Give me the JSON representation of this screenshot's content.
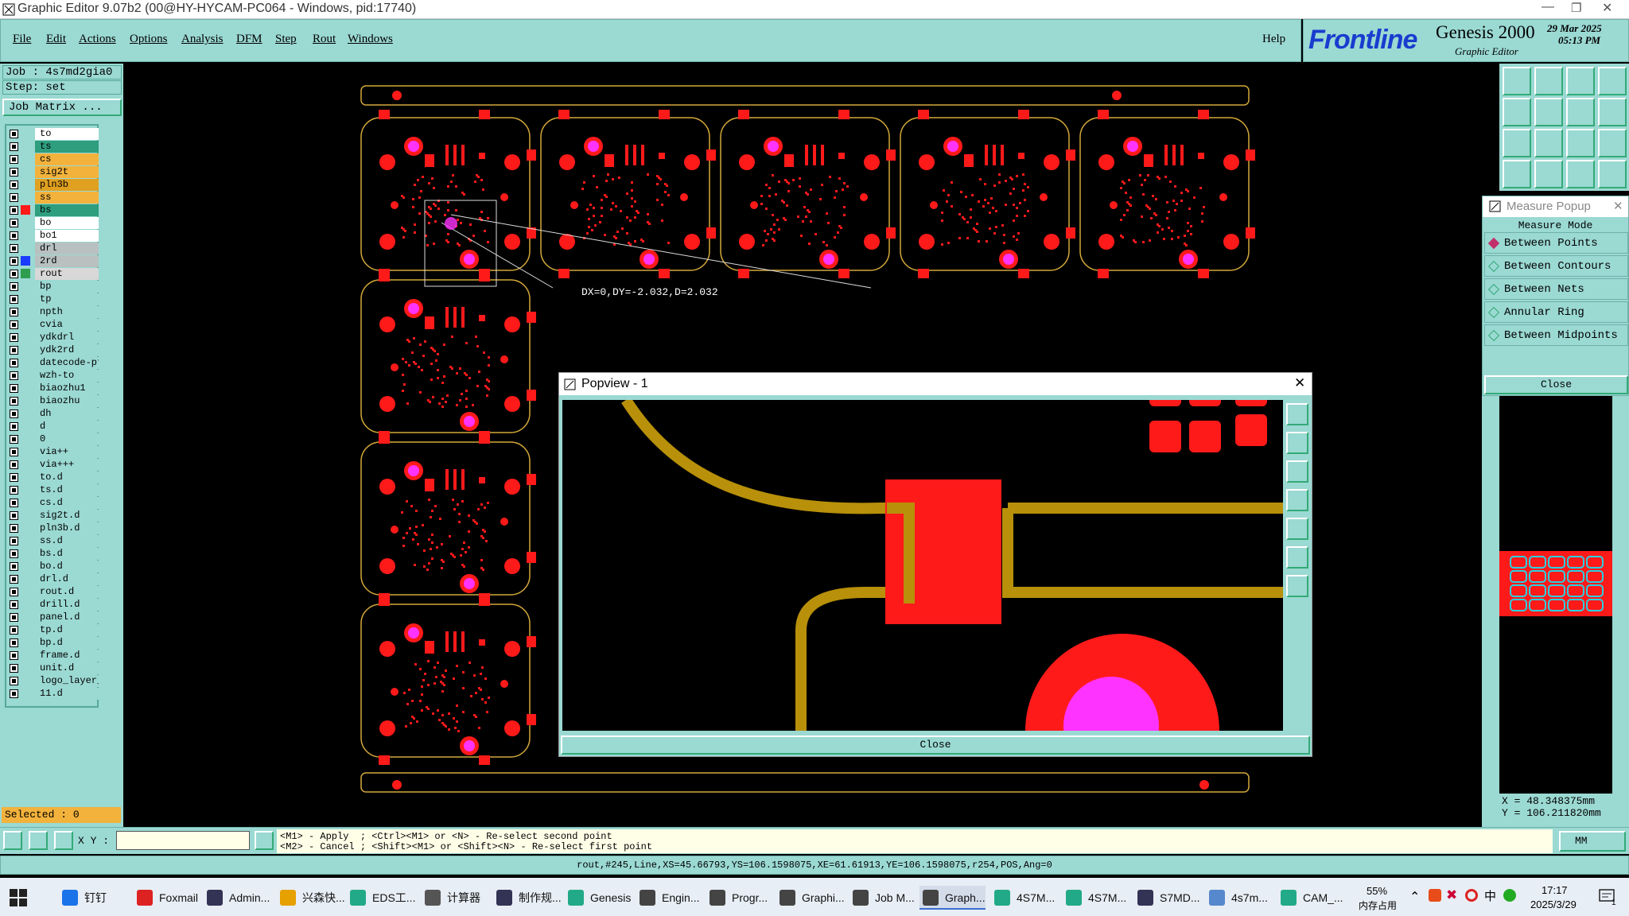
{
  "window": {
    "title": "Graphic Editor 9.07b2 (00@HY-HYCAM-PC064 - Windows, pid:17740)"
  },
  "menu": [
    "File",
    "Edit",
    "Actions",
    "Options",
    "Analysis",
    "DFM",
    "Step",
    "Rout",
    "Windows"
  ],
  "help": "Help",
  "brand": {
    "logo": "Frontline",
    "product": "Genesis 2000",
    "subtitle": "Graphic Editor",
    "date": "29 Mar 2025",
    "time": "05:13 PM"
  },
  "job": {
    "job_label": "Job : 4s7md2gia0",
    "step_label": "Step: set",
    "matrix_button": "Job Matrix ..."
  },
  "layers": [
    {
      "name": "to",
      "bg": "#ffffff",
      "sw": "#9bd9d3"
    },
    {
      "name": "ts",
      "bg": "#2e9e7e",
      "sw": "#9bd9d3"
    },
    {
      "name": "cs",
      "bg": "#f2b23c",
      "sw": "#9bd9d3"
    },
    {
      "name": "sig2t",
      "bg": "#f2b23c",
      "sw": "#9bd9d3"
    },
    {
      "name": "pln3b",
      "bg": "#e0a020",
      "sw": "#9bd9d3"
    },
    {
      "name": "ss",
      "bg": "#f2b23c",
      "sw": "#9bd9d3"
    },
    {
      "name": "bs",
      "bg": "#2e9e7e",
      "sw": "#ff1a1a"
    },
    {
      "name": "bo",
      "bg": "#ffffff",
      "sw": "#9bd9d3"
    },
    {
      "name": "bo1",
      "bg": "#ffffff",
      "sw": "#9bd9d3"
    },
    {
      "name": "drl",
      "bg": "#b8c0c0",
      "sw": "#9bd9d3"
    },
    {
      "name": "2rd",
      "bg": "#b8c0c0",
      "sw": "#1a3cff"
    },
    {
      "name": "rout",
      "bg": "#d8d8d8",
      "sw": "#2e9e4e"
    },
    {
      "name": "bp",
      "bg": "#9bd9d3",
      "sw": "#9bd9d3"
    },
    {
      "name": "tp",
      "bg": "#9bd9d3",
      "sw": "#9bd9d3"
    },
    {
      "name": "npth",
      "bg": "#9bd9d3",
      "sw": "#9bd9d3"
    },
    {
      "name": "cvia",
      "bg": "#9bd9d3",
      "sw": "#9bd9d3"
    },
    {
      "name": "ydkdrl",
      "bg": "#9bd9d3",
      "sw": "#9bd9d3"
    },
    {
      "name": "ydk2rd",
      "bg": "#9bd9d3",
      "sw": "#9bd9d3"
    },
    {
      "name": "datecode-pt",
      "bg": "#9bd9d3",
      "sw": "#9bd9d3"
    },
    {
      "name": "wzh-to",
      "bg": "#9bd9d3",
      "sw": "#9bd9d3"
    },
    {
      "name": "biaozhu1",
      "bg": "#9bd9d3",
      "sw": "#9bd9d3"
    },
    {
      "name": "biaozhu",
      "bg": "#9bd9d3",
      "sw": "#9bd9d3"
    },
    {
      "name": "dh",
      "bg": "#9bd9d3",
      "sw": "#9bd9d3"
    },
    {
      "name": "d",
      "bg": "#9bd9d3",
      "sw": "#9bd9d3"
    },
    {
      "name": "0",
      "bg": "#9bd9d3",
      "sw": "#9bd9d3"
    },
    {
      "name": "via++",
      "bg": "#9bd9d3",
      "sw": "#9bd9d3"
    },
    {
      "name": "via+++",
      "bg": "#9bd9d3",
      "sw": "#9bd9d3"
    },
    {
      "name": "to.d",
      "bg": "#9bd9d3",
      "sw": "#9bd9d3"
    },
    {
      "name": "ts.d",
      "bg": "#9bd9d3",
      "sw": "#9bd9d3"
    },
    {
      "name": "cs.d",
      "bg": "#9bd9d3",
      "sw": "#9bd9d3"
    },
    {
      "name": "sig2t.d",
      "bg": "#9bd9d3",
      "sw": "#9bd9d3"
    },
    {
      "name": "pln3b.d",
      "bg": "#9bd9d3",
      "sw": "#9bd9d3"
    },
    {
      "name": "ss.d",
      "bg": "#9bd9d3",
      "sw": "#9bd9d3"
    },
    {
      "name": "bs.d",
      "bg": "#9bd9d3",
      "sw": "#9bd9d3"
    },
    {
      "name": "bo.d",
      "bg": "#9bd9d3",
      "sw": "#9bd9d3"
    },
    {
      "name": "drl.d",
      "bg": "#9bd9d3",
      "sw": "#9bd9d3"
    },
    {
      "name": "rout.d",
      "bg": "#9bd9d3",
      "sw": "#9bd9d3"
    },
    {
      "name": "drill.d",
      "bg": "#9bd9d3",
      "sw": "#9bd9d3"
    },
    {
      "name": "panel.d",
      "bg": "#9bd9d3",
      "sw": "#9bd9d3"
    },
    {
      "name": "tp.d",
      "bg": "#9bd9d3",
      "sw": "#9bd9d3"
    },
    {
      "name": "bp.d",
      "bg": "#9bd9d3",
      "sw": "#9bd9d3"
    },
    {
      "name": "frame.d",
      "bg": "#9bd9d3",
      "sw": "#9bd9d3"
    },
    {
      "name": "unit.d",
      "bg": "#9bd9d3",
      "sw": "#9bd9d3"
    },
    {
      "name": "logo_layer_",
      "bg": "#9bd9d3",
      "sw": "#9bd9d3"
    },
    {
      "name": "11.d",
      "bg": "#9bd9d3",
      "sw": "#9bd9d3"
    }
  ],
  "selected": "Selected : 0",
  "canvas": {
    "measure_label": "DX=0,DY=-2.032,D=2.032"
  },
  "measure_popup": {
    "title": "Measure Popup",
    "mode_label": "Measure Mode",
    "options": [
      "Between Points",
      "Between Contours",
      "Between Nets",
      "Annular Ring",
      "Between Midpoints"
    ],
    "close": "Close"
  },
  "popview": {
    "title": "Popview - 1",
    "close": "Close"
  },
  "coords": {
    "x": "X = 48.348375mm",
    "y": "Y = 106.211820mm"
  },
  "command": {
    "xy_label": "X Y :",
    "xy_value": "",
    "hint1": "<M1> - Apply  ; <Ctrl><M1> or <N> - Re-select second point",
    "hint2": "<M2> - Cancel ; <Shift><M1> or <Shift><N> - Re-select first point",
    "units": "MM"
  },
  "status": "rout,#245,Line,XS=45.66793,YS=106.1598075,XE=61.61913,YE=106.1598075,r254,POS,Ang=0",
  "taskbar": {
    "items": [
      "钉钉",
      "Foxmail",
      "Admin...",
      "兴森快...",
      "EDS工...",
      "计算器",
      "制作规...",
      "Genesis",
      "Engin...",
      "Progr...",
      "Graphi...",
      "Job M...",
      "Graph...",
      "4S7M...",
      "4S7M...",
      "S7MD...",
      "4s7m...",
      "CAM_..."
    ],
    "mem_pct": "55%",
    "mem_label": "内存占用",
    "ime": "中",
    "time": "17:17",
    "date": "2025/3/29",
    "notif": "1"
  },
  "colors": {
    "teal": "#9bd9d3",
    "pad": "#ff1a1a",
    "trace": "#b8900a",
    "outline": "#d4a93a",
    "drill": "#ff33ff"
  }
}
